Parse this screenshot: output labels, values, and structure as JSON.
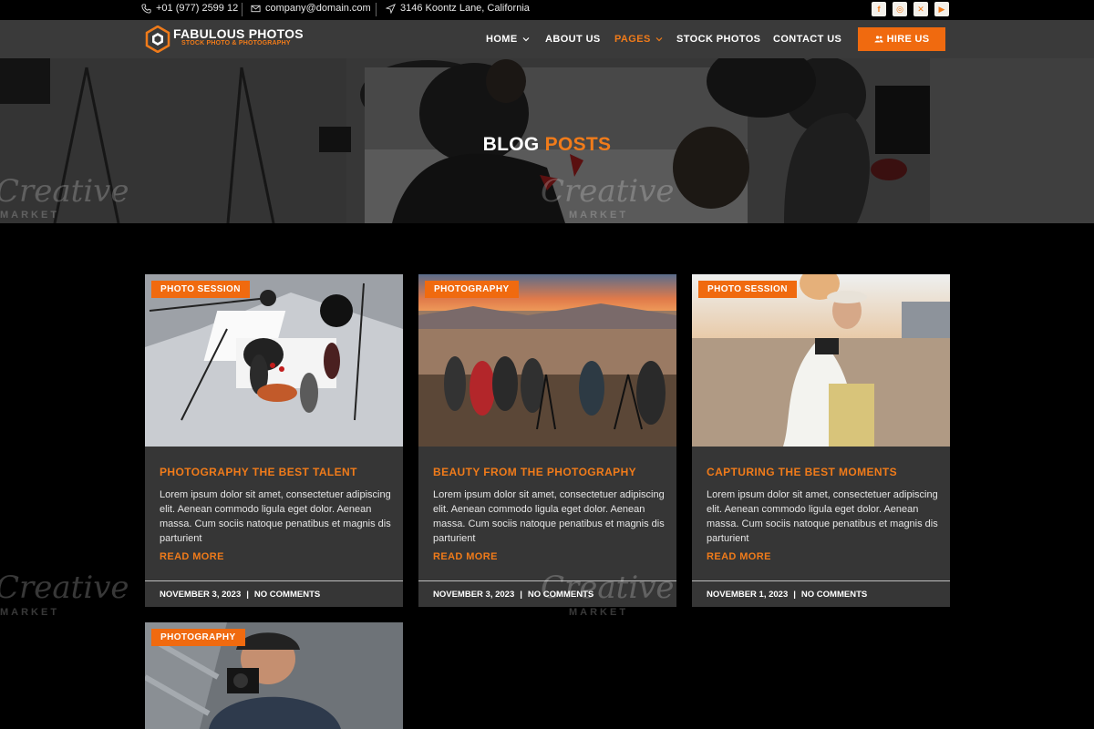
{
  "topbar": {
    "phone": "+01 (977) 2599 12",
    "email": "company@domain.com",
    "address": "3146 Koontz Lane, California",
    "social": [
      {
        "icon": "facebook-icon",
        "glyph": "f"
      },
      {
        "icon": "instagram-icon",
        "glyph": "◎"
      },
      {
        "icon": "x-icon",
        "glyph": "✕"
      },
      {
        "icon": "youtube-icon",
        "glyph": "▶"
      }
    ]
  },
  "brand": {
    "name": "FABULOUS PHOTOS",
    "tagline": "STOCK PHOTO & PHOTOGRAPHY"
  },
  "nav": {
    "items": [
      {
        "label": "HOME",
        "dropdown": true
      },
      {
        "label": "ABOUT US",
        "dropdown": false
      },
      {
        "label": "PAGES",
        "dropdown": true,
        "active": true
      },
      {
        "label": "STOCK PHOTOS",
        "dropdown": false
      },
      {
        "label": "CONTACT US",
        "dropdown": false
      }
    ],
    "cta": "HIRE US"
  },
  "hero": {
    "title_word1": "BLOG",
    "title_word2": "POSTS"
  },
  "posts": [
    {
      "category": "PHOTO SESSION",
      "title": "PHOTOGRAPHY THE BEST TALENT",
      "excerpt": "Lorem ipsum dolor sit amet, consectetuer adipiscing elit. Aenean commodo ligula eget dolor. Aenean massa. Cum sociis natoque penatibus et magnis dis parturient",
      "read_more": "READ MORE",
      "date": "NOVEMBER 3, 2023",
      "comments": "NO COMMENTS"
    },
    {
      "category": "PHOTOGRAPHY",
      "title": "BEAUTY FROM THE PHOTOGRAPHY",
      "excerpt": "Lorem ipsum dolor sit amet, consectetuer adipiscing elit. Aenean commodo ligula eget dolor. Aenean massa. Cum sociis natoque penatibus et magnis dis parturient",
      "read_more": "READ MORE",
      "date": "NOVEMBER 3, 2023",
      "comments": "NO COMMENTS"
    },
    {
      "category": "PHOTO SESSION",
      "title": "CAPTURING THE BEST MOMENTS",
      "excerpt": "Lorem ipsum dolor sit amet, consectetuer adipiscing elit. Aenean commodo ligula eget dolor. Aenean massa. Cum sociis natoque penatibus et magnis dis parturient",
      "read_more": "READ MORE",
      "date": "NOVEMBER 1, 2023",
      "comments": "NO COMMENTS"
    },
    {
      "category": "PHOTOGRAPHY"
    }
  ],
  "watermark": {
    "word": "Creative",
    "sub": "MARKET"
  },
  "colors": {
    "accent": "#f06a0f",
    "accent_text": "#f07b1a",
    "card_bg": "#363636",
    "nav_bg": "#3a3a3a",
    "page_bg": "#000000"
  }
}
